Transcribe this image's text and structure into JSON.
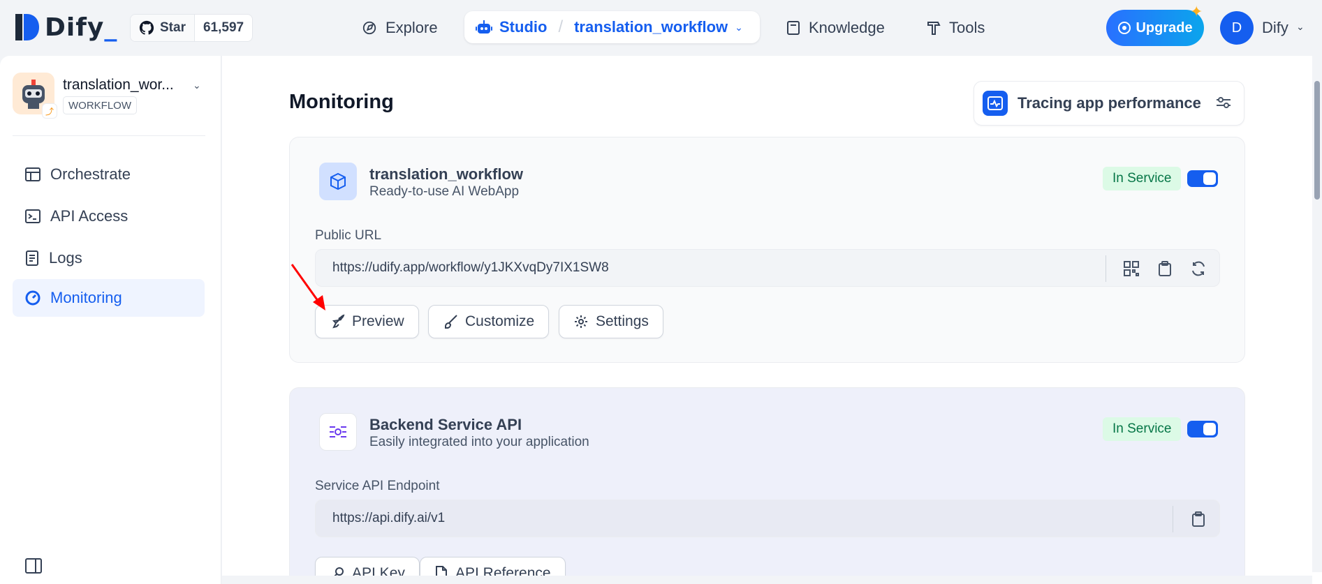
{
  "brand": {
    "logo_text": "Dify",
    "accent": "#155eef"
  },
  "github": {
    "star_label": "Star",
    "count": "61,597"
  },
  "nav": {
    "explore": "Explore",
    "studio": "Studio",
    "separator": "/",
    "current_app": "translation_workflow",
    "knowledge": "Knowledge",
    "tools": "Tools"
  },
  "header": {
    "upgrade_label": "Upgrade",
    "user_initial": "D",
    "user_name": "Dify"
  },
  "sidebar": {
    "app_name": "translation_wor...",
    "app_type": "WORKFLOW",
    "items": [
      {
        "label": "Orchestrate",
        "icon": "layout-icon"
      },
      {
        "label": "API Access",
        "icon": "terminal-icon"
      },
      {
        "label": "Logs",
        "icon": "file-list-icon"
      },
      {
        "label": "Monitoring",
        "icon": "dashboard-icon",
        "active": true
      }
    ]
  },
  "main": {
    "title": "Monitoring",
    "tracing_label": "Tracing app performance",
    "webapp_card": {
      "title": "translation_workflow",
      "subtitle": "Ready-to-use AI WebApp",
      "status": "In Service",
      "enabled": true,
      "field_label": "Public URL",
      "url": "https://udify.app/workflow/y1JKXvqDy7IX1SW8",
      "buttons": {
        "preview": "Preview",
        "customize": "Customize",
        "settings": "Settings"
      }
    },
    "api_card": {
      "title": "Backend Service API",
      "subtitle": "Easily integrated into your application",
      "status": "In Service",
      "enabled": true,
      "field_label": "Service API Endpoint",
      "url": "https://api.dify.ai/v1",
      "buttons": {
        "api_key": "API Key",
        "api_reference": "API Reference"
      }
    }
  },
  "colors": {
    "status_bg": "#dcfae6",
    "status_text": "#067647",
    "annotation_arrow": "#ff0000"
  }
}
